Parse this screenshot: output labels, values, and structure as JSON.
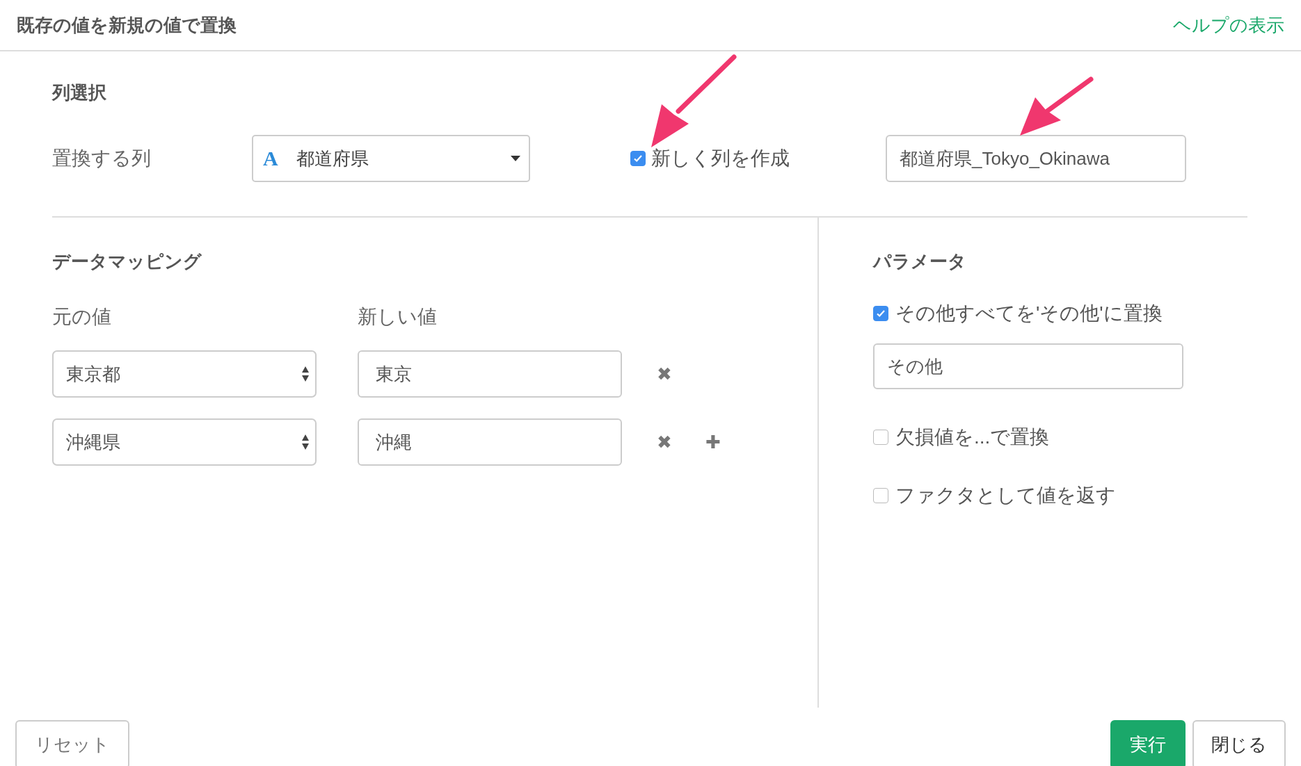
{
  "header": {
    "title": "既存の値を新規の値で置換",
    "help_link": "ヘルプの表示"
  },
  "column_selection": {
    "heading": "列選択",
    "label": "置換する列",
    "column_type_icon": "A",
    "column": "都道府県",
    "new_column": {
      "label": "新しく列を作成",
      "checked": true
    },
    "new_column_name": "都道府県_Tokyo_Okinawa"
  },
  "data_mapping": {
    "heading": "データマッピング",
    "original_label": "元の値",
    "new_label": "新しい値",
    "rows": [
      {
        "original": "東京都",
        "new_value": "東京",
        "remove": "✖",
        "add": null
      },
      {
        "original": "沖縄県",
        "new_value": "沖縄",
        "remove": "✖",
        "add": "✚"
      }
    ]
  },
  "parameters": {
    "heading": "パラメータ",
    "replace_others": {
      "label": "その他すべてを'その他'に置換",
      "checked": true
    },
    "others_value": "その他",
    "options": [
      {
        "label": "欠損値を...で置換",
        "checked": false
      },
      {
        "label": "ファクタとして値を返す",
        "checked": false
      }
    ]
  },
  "footer": {
    "buttons": [
      {
        "label": "リセット",
        "kind": "default"
      },
      {
        "label": "実行",
        "kind": "primary"
      },
      {
        "label": "閉じる",
        "kind": "default"
      }
    ]
  }
}
